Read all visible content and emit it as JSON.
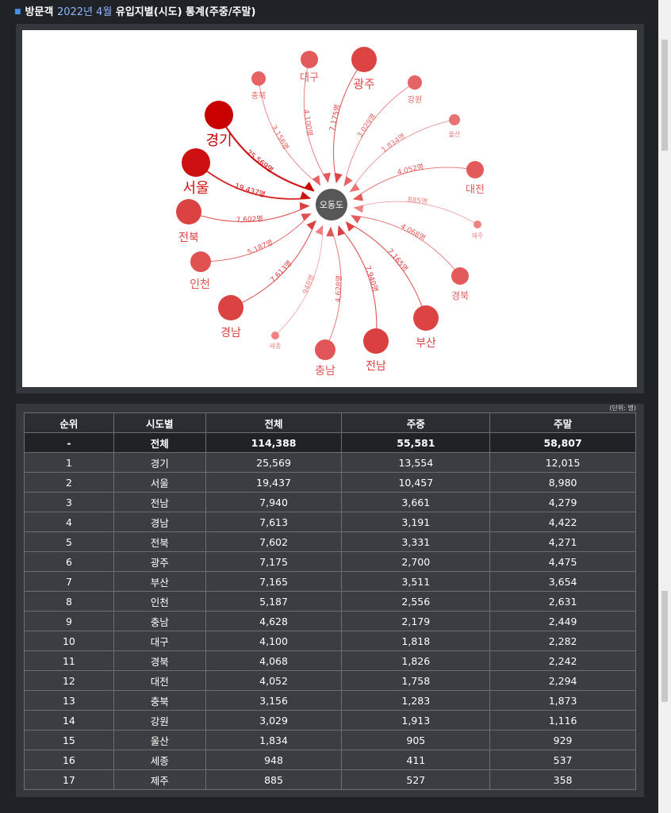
{
  "header": {
    "bullet": "■",
    "prefix": "방문객",
    "period": "2022년 4월",
    "suffix": "유입지별(시도) 통계(주중/주말)"
  },
  "chart_data": {
    "type": "flow-network",
    "center_label": "오동도",
    "nodes": [
      {
        "region": "경기",
        "total": 25569,
        "flow_label": "25,569명"
      },
      {
        "region": "서울",
        "total": 19437,
        "flow_label": "19,437명"
      },
      {
        "region": "전남",
        "total": 7940,
        "flow_label": "7,940명"
      },
      {
        "region": "경남",
        "total": 7613,
        "flow_label": "7,613명"
      },
      {
        "region": "전북",
        "total": 7602,
        "flow_label": "7,602명"
      },
      {
        "region": "광주",
        "total": 7175,
        "flow_label": "7,175명"
      },
      {
        "region": "부산",
        "total": 7165,
        "flow_label": "7,165명"
      },
      {
        "region": "인천",
        "total": 5187,
        "flow_label": "5,187명"
      },
      {
        "region": "충남",
        "total": 4628,
        "flow_label": "4,628명"
      },
      {
        "region": "대구",
        "total": 4100,
        "flow_label": "4,100명"
      },
      {
        "region": "경북",
        "total": 4068,
        "flow_label": "4,068명"
      },
      {
        "region": "대전",
        "total": 4052,
        "flow_label": "4,052명"
      },
      {
        "region": "충북",
        "total": 3156,
        "flow_label": "3,156명"
      },
      {
        "region": "강원",
        "total": 3029,
        "flow_label": "3,029명"
      },
      {
        "region": "울산",
        "total": 1834,
        "flow_label": "1,834명"
      },
      {
        "region": "세종",
        "total": 948,
        "flow_label": "948명"
      },
      {
        "region": "제주",
        "total": 885,
        "flow_label": "885명"
      }
    ]
  },
  "table": {
    "unit_note": "(단위: 명)",
    "columns": [
      "순위",
      "시도별",
      "전체",
      "주중",
      "주말"
    ],
    "total_row": [
      "-",
      "전체",
      "114,388",
      "55,581",
      "58,807"
    ],
    "rows": [
      [
        "1",
        "경기",
        "25,569",
        "13,554",
        "12,015"
      ],
      [
        "2",
        "서울",
        "19,437",
        "10,457",
        "8,980"
      ],
      [
        "3",
        "전남",
        "7,940",
        "3,661",
        "4,279"
      ],
      [
        "4",
        "경남",
        "7,613",
        "3,191",
        "4,422"
      ],
      [
        "5",
        "전북",
        "7,602",
        "3,331",
        "4,271"
      ],
      [
        "6",
        "광주",
        "7,175",
        "2,700",
        "4,475"
      ],
      [
        "7",
        "부산",
        "7,165",
        "3,511",
        "3,654"
      ],
      [
        "8",
        "인천",
        "5,187",
        "2,556",
        "2,631"
      ],
      [
        "9",
        "충남",
        "4,628",
        "2,179",
        "2,449"
      ],
      [
        "10",
        "대구",
        "4,100",
        "1,818",
        "2,282"
      ],
      [
        "11",
        "경북",
        "4,068",
        "1,826",
        "2,242"
      ],
      [
        "12",
        "대전",
        "4,052",
        "1,758",
        "2,294"
      ],
      [
        "13",
        "충북",
        "3,156",
        "1,283",
        "1,873"
      ],
      [
        "14",
        "강원",
        "3,029",
        "1,913",
        "1,116"
      ],
      [
        "15",
        "울산",
        "1,834",
        "905",
        "929"
      ],
      [
        "16",
        "세종",
        "948",
        "411",
        "537"
      ],
      [
        "17",
        "제주",
        "885",
        "527",
        "358"
      ]
    ]
  }
}
